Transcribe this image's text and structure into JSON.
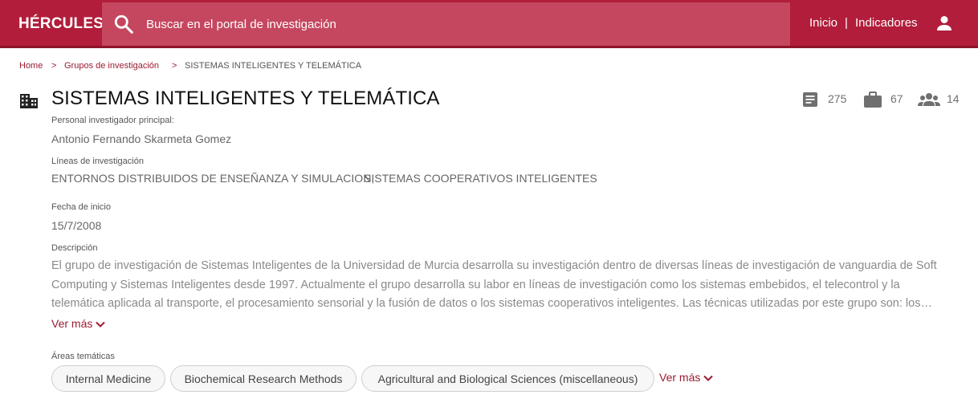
{
  "header": {
    "brand": "HÉRCULES",
    "search_placeholder": "Buscar en el portal de investigación",
    "nav_inicio": "Inicio",
    "nav_separator": "|",
    "nav_indicadores": "Indicadores"
  },
  "breadcrumb": {
    "home": "Home",
    "sep": ">",
    "groups": "Grupos de investigación",
    "current": "SISTEMAS INTELIGENTES Y TELEMÁTICA"
  },
  "group": {
    "title": "SISTEMAS INTELIGENTES Y TELEMÁTICA",
    "stats": {
      "publications": "275",
      "projects": "67",
      "members": "14"
    },
    "pi_label": "Personal investigador principal:",
    "pi_name": "Antonio Fernando Skarmeta Gomez",
    "lines_label": "Líneas de investigación",
    "line_1": "ENTORNOS DISTRIBUIDOS DE ENSEÑANZA Y SIMULACION,",
    "line_2": "SISTEMAS COOPERATIVOS INTELIGENTES",
    "start_label": "Fecha de inicio",
    "start_date": "15/7/2008",
    "desc_label": "Descripción",
    "description": "El grupo de investigación de Sistemas Inteligentes de la Universidad de Murcia desarrolla su investigación dentro de diversas líneas de investigación de vanguardia de Soft Computing y Sistemas Inteligentes desde 1997. Actualmente el grupo desarrolla su labor en líneas de investigación como los sistemas embebidos, el telecontrol y la telemática aplicada al transporte, el procesamiento sensorial y la fusión de datos o los sistemas cooperativos inteligentes. Las técnicas utilizadas por este grupo son: los…",
    "ver_mas": "Ver más",
    "areas_label": "Áreas temáticas",
    "areas": [
      "Internal Medicine",
      "Biochemical Research Methods",
      "Agricultural and Biological Sciences (miscellaneous)"
    ],
    "areas_ver_mas": "Ver más"
  },
  "colors": {
    "brand_red": "#b11d3a",
    "link_red": "#9b1b30"
  }
}
